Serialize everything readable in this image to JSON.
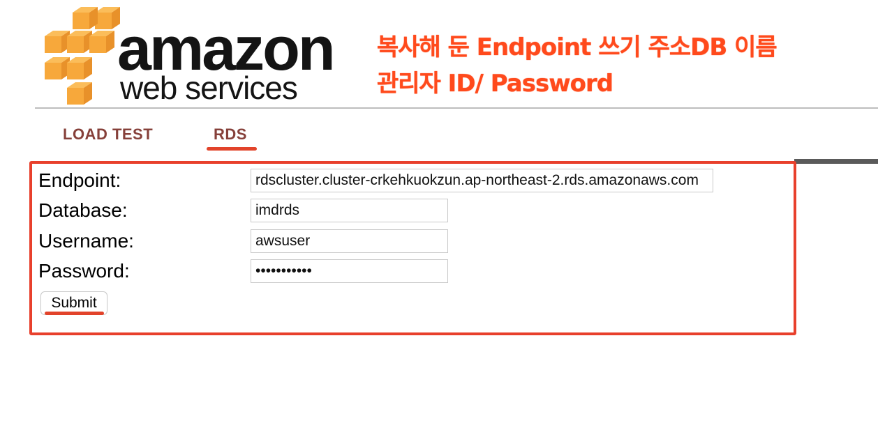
{
  "logo": {
    "word1": "amazon",
    "word2": "web services",
    "cube_color": "#f7a83b"
  },
  "annotation": {
    "line1": "복사해 둔 Endpoint 쓰기 주소DB 이름",
    "line2": "관리자 ID/ Password",
    "color": "#ff4a1c"
  },
  "tabs": [
    {
      "label": "LOAD TEST",
      "active": false
    },
    {
      "label": "RDS",
      "active": true
    }
  ],
  "form": {
    "fields": [
      {
        "label": "Endpoint:",
        "value": "rdscluster.cluster-crkehkuokzun.ap-northeast-2.rds.amazonaws.com"
      },
      {
        "label": "Database:",
        "value": "imdrds"
      },
      {
        "label": "Username:",
        "value": "awsuser"
      },
      {
        "label": "Password:",
        "value": "•••••••••••"
      }
    ],
    "submit_label": "Submit"
  },
  "colors": {
    "highlight": "#e8402c",
    "tab_text": "#86403a"
  }
}
